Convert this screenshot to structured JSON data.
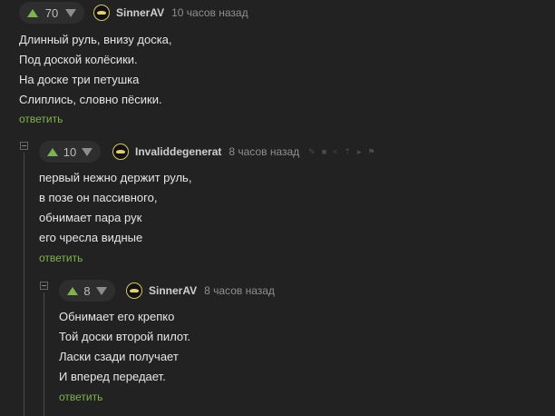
{
  "comments": [
    {
      "rating": "70",
      "author": "SinnerAV",
      "time": "10 часов назад",
      "lines": [
        "Длинный руль, внизу доска,",
        "Под доской колёсики.",
        "На доске три петушка",
        "Слиплись, словно пёсики."
      ],
      "reply": "ответить"
    },
    {
      "rating": "10",
      "author": "Invaliddegenerat",
      "time": "8 часов назад",
      "lines": [
        "первый нежно держит руль,",
        "в позе он пассивного,",
        "обнимает пара рук",
        "его чресла видные"
      ],
      "reply": "ответить",
      "action_icons": [
        "edit-icon",
        "save-icon",
        "share-icon",
        "pin-icon",
        "pointer-icon",
        "flag-icon"
      ]
    },
    {
      "rating": "8",
      "author": "SinnerAV",
      "time": "8 часов назад",
      "lines": [
        "Обнимает его крепко",
        "Той доски второй пилот.",
        "Ласки сзади получает",
        "И вперед передает."
      ],
      "reply": "ответить"
    }
  ],
  "colors": {
    "background": "#222222",
    "upvote": "#7fb34c",
    "reply_link": "#7fb34c",
    "text": "#e6e6e6",
    "meta": "#8f8f8f"
  }
}
